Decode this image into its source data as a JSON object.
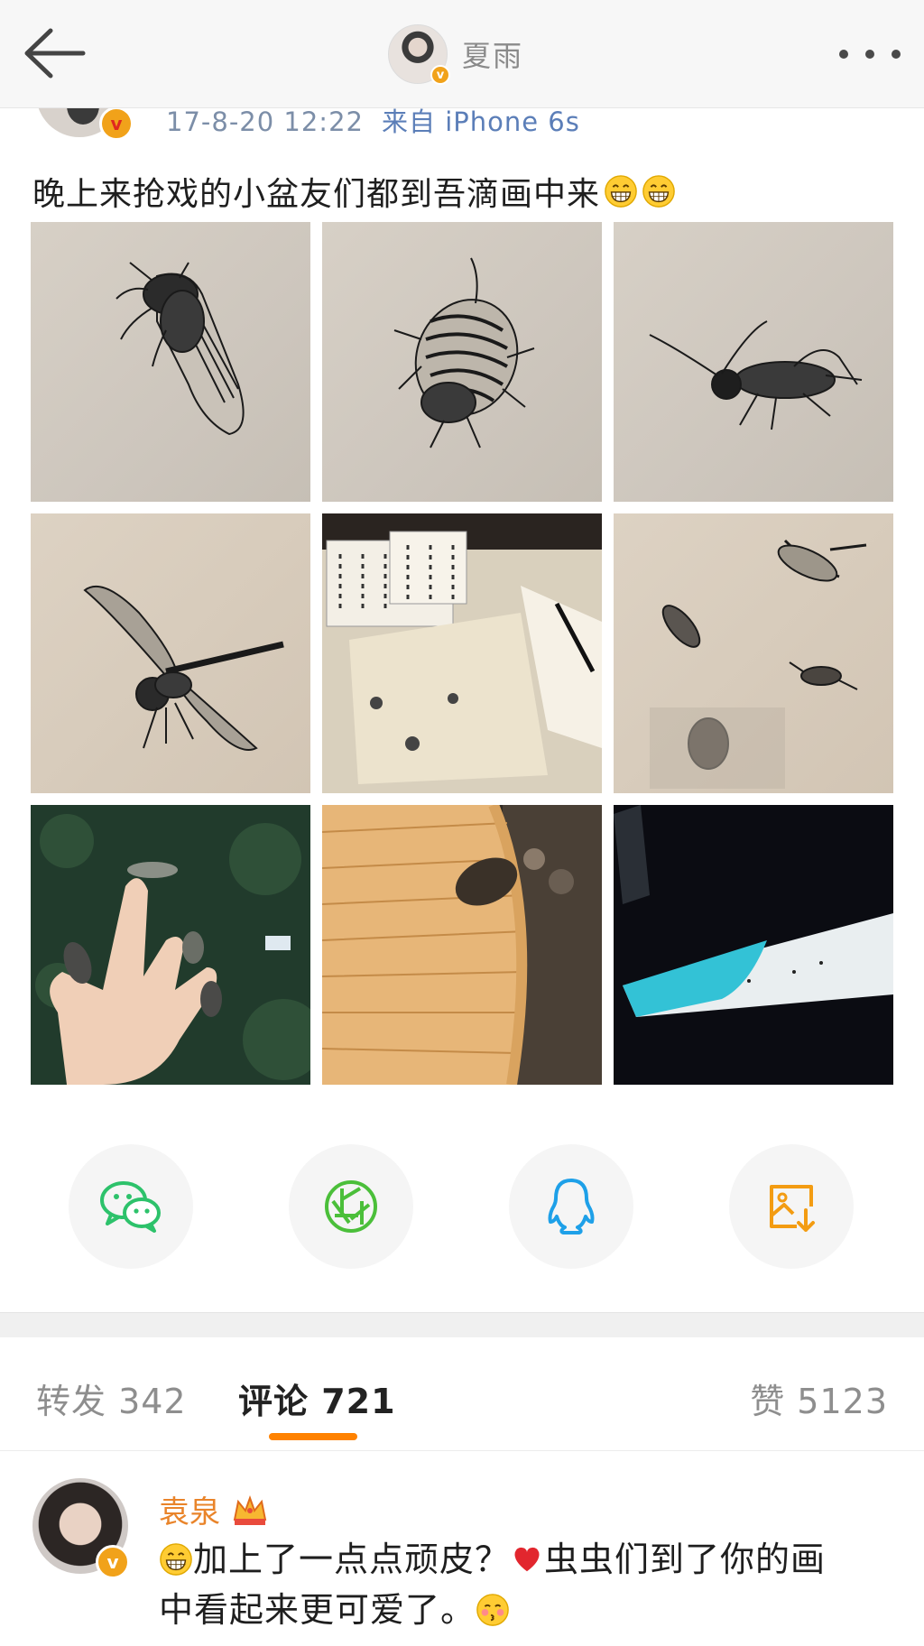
{
  "nav": {
    "username": "夏雨",
    "back_icon": "arrow-left-icon",
    "more_icon": "more-dots-icon"
  },
  "post": {
    "timestamp": "17-8-20 12:22",
    "source": "来自 iPhone 6s",
    "text": "晚上来抢戏的小盆友们都到吾滴画中来",
    "emoji": "grin-emoji",
    "images": [
      "cicada-ink-drawing",
      "beetle-ink-drawing",
      "cricket-ink-drawing",
      "dragonfly-ink-drawing",
      "scrolls-and-insects-on-table",
      "insects-on-paper-photo",
      "hand-with-cicadas-photo",
      "cicada-on-bamboo-fan-photo",
      "projection-screen-photo"
    ]
  },
  "share": [
    {
      "name": "wechat-share-button",
      "icon": "wechat-icon",
      "color": "#2dc26b"
    },
    {
      "name": "moments-share-button",
      "icon": "moments-aperture-icon",
      "color": "#4bbf3a"
    },
    {
      "name": "qq-share-button",
      "icon": "qq-penguin-icon",
      "color": "#1ea0e8"
    },
    {
      "name": "save-image-button",
      "icon": "save-image-icon",
      "color": "#f39c12"
    }
  ],
  "tabs": {
    "repost": "转发 342",
    "comments": "评论 721",
    "likes": "赞 5123",
    "accent": "#ff8200"
  },
  "comment": {
    "author": "袁泉",
    "badge": "crown-icon",
    "line1": "加上了一点点顽皮？",
    "line2": "虫虫们到了你的画",
    "line3": "中看起来更可爱了。"
  }
}
